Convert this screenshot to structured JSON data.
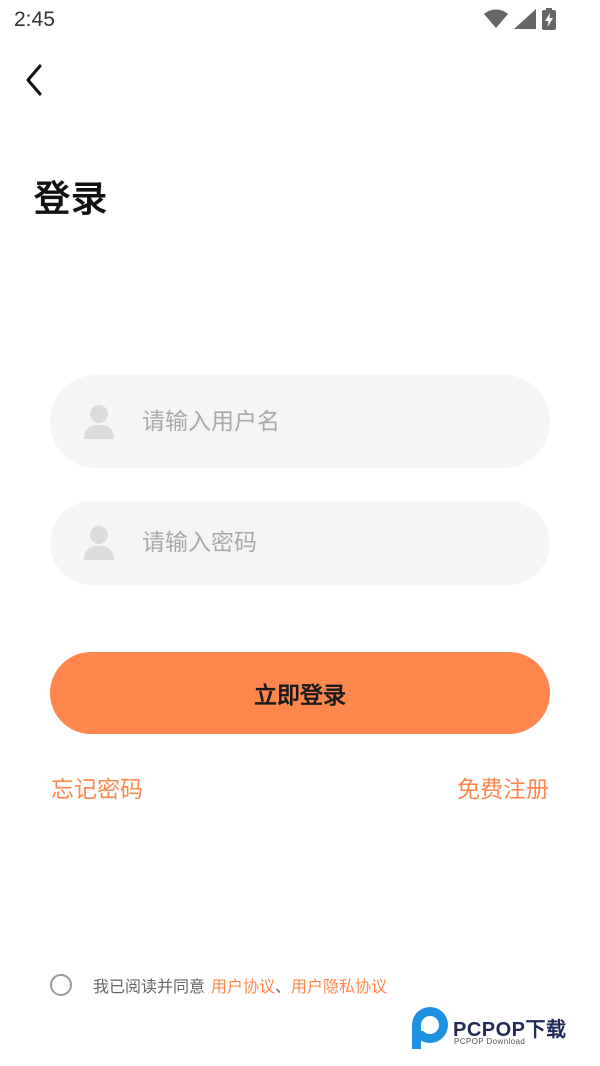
{
  "status_bar": {
    "time": "2:45",
    "icons": [
      "wifi-icon",
      "signal-icon",
      "battery-charging-icon"
    ]
  },
  "header": {
    "back_icon": "chevron-left-icon",
    "title": "登录"
  },
  "form": {
    "username": {
      "placeholder": "请输入用户名",
      "value": "",
      "icon": "user-icon"
    },
    "password": {
      "placeholder": "请输入密码",
      "value": "",
      "icon": "user-icon"
    },
    "login_label": "立即登录"
  },
  "links": {
    "forgot_password": "忘记密码",
    "register": "免费注册"
  },
  "agreement": {
    "checked": false,
    "prefix": "我已阅读并同意",
    "user_agreement": "用户协议",
    "separator": "、",
    "privacy_policy": "用户隐私协议"
  },
  "watermark": {
    "text": "PCPOP下载",
    "subtext": "PCPOP Download"
  },
  "colors": {
    "accent": "#ff874d",
    "field_bg": "#f5f5f5",
    "placeholder": "#a9a9a9"
  }
}
